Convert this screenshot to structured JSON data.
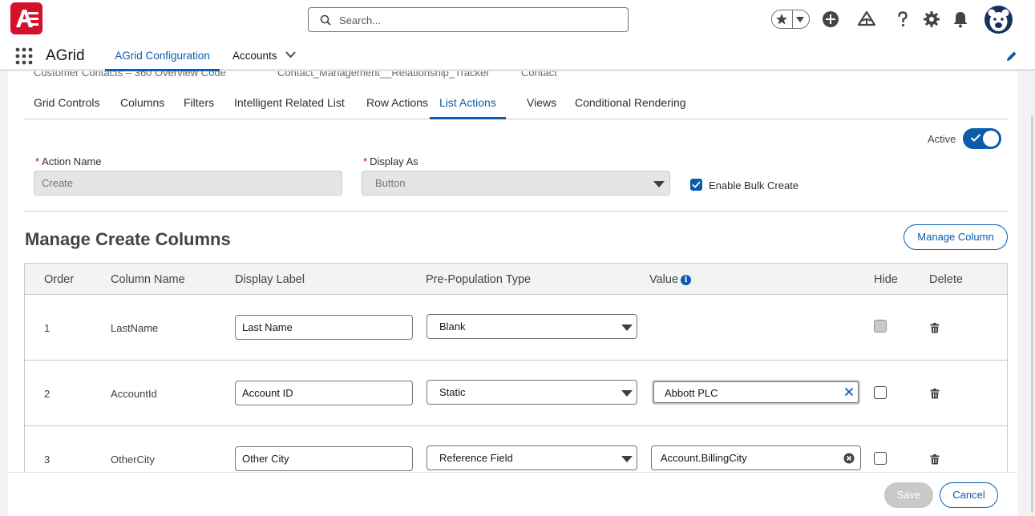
{
  "header": {
    "search_placeholder": "Search..."
  },
  "app": {
    "name": "AGrid",
    "tabs": [
      {
        "label": "AGrid Configuration"
      },
      {
        "label": "Accounts"
      }
    ]
  },
  "ghost_row": [
    "Customer Contacts – 360 Overview Code",
    "Contact_Management__Relationship_Tracker",
    "Contact"
  ],
  "config_tabs": [
    {
      "label": "Grid Controls"
    },
    {
      "label": "Columns"
    },
    {
      "label": "Filters"
    },
    {
      "label": "Intelligent Related List"
    },
    {
      "label": "Row Actions"
    },
    {
      "label": "List Actions",
      "active": true
    },
    {
      "label": "Views"
    },
    {
      "label": "Conditional Rendering"
    }
  ],
  "active_toggle": {
    "label": "Active",
    "value": true
  },
  "action_name": {
    "label": "Action Name",
    "value": "Create"
  },
  "display_as": {
    "label": "Display As",
    "value": "Button"
  },
  "bulk_create": {
    "label": "Enable Bulk Create",
    "checked": true
  },
  "section_title": "Manage Create Columns",
  "manage_column_label": "Manage Column",
  "table": {
    "headers": [
      "Order",
      "Column Name",
      "Display Label",
      "Pre-Population Type",
      "Value",
      "Hide",
      "Delete"
    ],
    "rows": [
      {
        "order": "1",
        "column_name": "LastName",
        "display_label": "Last Name",
        "type": "Blank",
        "value": "",
        "hide": false
      },
      {
        "order": "2",
        "column_name": "AccountId",
        "display_label": "Account ID",
        "type": "Static",
        "value": "Abbott PLC",
        "hide": false
      },
      {
        "order": "3",
        "column_name": "OtherCity",
        "display_label": "Other City",
        "type": "Reference Field",
        "value": "Account.BillingCity",
        "hide": false
      }
    ]
  },
  "footer": {
    "save_label": "Save",
    "cancel_label": "Cancel"
  },
  "colors": {
    "brand_blue": "#0b5cab",
    "logo_red": "#d4102a"
  }
}
